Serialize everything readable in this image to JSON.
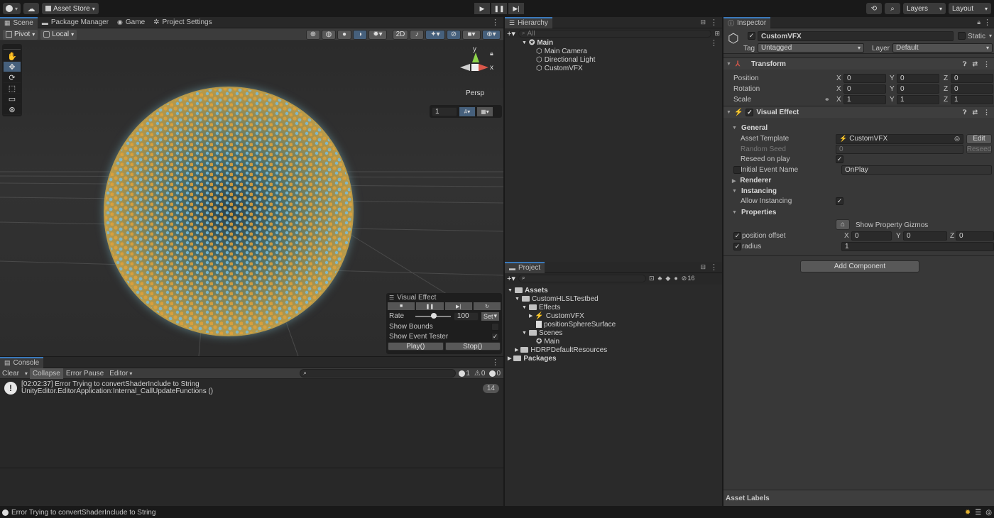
{
  "toolbar": {
    "account_icon": "account-icon",
    "asset_store": "Asset Store"
  },
  "scene_tabs": [
    {
      "label": "Scene",
      "icon": "scene-icon"
    },
    {
      "label": "Package Manager",
      "icon": "package-icon"
    },
    {
      "label": "Game",
      "icon": "game-icon"
    },
    {
      "label": "Project Settings",
      "icon": "gear-icon"
    }
  ],
  "scene_toolbar": {
    "pivot": "Pivot",
    "local": "Local",
    "mode_2d": "2D"
  },
  "gizmo": {
    "y": "y",
    "x": "x",
    "persp": "Persp",
    "grid_value": "1"
  },
  "vfx_overlay": {
    "title": "Visual Effect",
    "rate_label": "Rate",
    "rate_value": "100",
    "set_label": "Set",
    "show_bounds": "Show Bounds",
    "show_event_tester": "Show Event Tester",
    "play": "Play()",
    "stop": "Stop()"
  },
  "console": {
    "tab": "Console",
    "clear": "Clear",
    "collapse": "Collapse",
    "error_pause": "Error Pause",
    "editor": "Editor",
    "count_errors": "1",
    "count_warnings": "0",
    "count_logs": "0",
    "msg_line1": "[02:02:37] Error Trying to convertShaderInclude to String",
    "msg_line2": "UnityEditor.EditorApplication:Internal_CallUpdateFunctions ()",
    "msg_count": "14"
  },
  "status_bar": {
    "text": "Error Trying to convertShaderInclude to String"
  },
  "hierarchy": {
    "tab": "Hierarchy",
    "search_placeholder": "All",
    "scene": "Main",
    "items": [
      "Main Camera",
      "Directional Light",
      "CustomVFX"
    ]
  },
  "project": {
    "tab": "Project",
    "hidden_count": "16",
    "tree": [
      {
        "label": "Assets",
        "depth": 0,
        "type": "folder",
        "bold": true
      },
      {
        "label": "CustomHLSLTestbed",
        "depth": 1,
        "type": "folder"
      },
      {
        "label": "Effects",
        "depth": 2,
        "type": "folder"
      },
      {
        "label": "CustomVFX",
        "depth": 3,
        "type": "vfx"
      },
      {
        "label": "positionSphereSurface",
        "depth": 3,
        "type": "file"
      },
      {
        "label": "Scenes",
        "depth": 2,
        "type": "folder"
      },
      {
        "label": "Main",
        "depth": 3,
        "type": "scene"
      },
      {
        "label": "HDRPDefaultResources",
        "depth": 1,
        "type": "folder"
      },
      {
        "label": "Packages",
        "depth": 0,
        "type": "folder",
        "bold": true
      }
    ]
  },
  "top_right": {
    "layers": "Layers",
    "layout": "Layout"
  },
  "inspector": {
    "tab": "Inspector",
    "object_name": "CustomVFX",
    "static_label": "Static",
    "tag_label": "Tag",
    "tag_value": "Untagged",
    "layer_label": "Layer",
    "layer_value": "Default",
    "transform": {
      "title": "Transform",
      "position": {
        "label": "Position",
        "x": "0",
        "y": "0",
        "z": "0"
      },
      "rotation": {
        "label": "Rotation",
        "x": "0",
        "y": "0",
        "z": "0"
      },
      "scale": {
        "label": "Scale",
        "x": "1",
        "y": "1",
        "z": "1"
      }
    },
    "axis": {
      "x": "X",
      "y": "Y",
      "z": "Z"
    },
    "vfx": {
      "title": "Visual Effect",
      "general": "General",
      "asset_template_label": "Asset Template",
      "asset_template_value": "CustomVFX",
      "edit": "Edit",
      "random_seed_label": "Random Seed",
      "random_seed_value": "0",
      "reseed": "Reseed",
      "reseed_on_play": "Reseed on play",
      "initial_event_label": "Initial Event Name",
      "initial_event_value": "OnPlay",
      "renderer": "Renderer",
      "instancing": "Instancing",
      "allow_instancing": "Allow Instancing",
      "properties": "Properties",
      "show_gizmos": "Show Property Gizmos",
      "position_offset": {
        "label": "position offset",
        "x": "0",
        "y": "0",
        "z": "0"
      },
      "radius": {
        "label": "radius",
        "value": "1"
      }
    },
    "add_component": "Add Component",
    "asset_labels": "Asset Labels"
  },
  "colors": {
    "accent": "#3a79bb",
    "particle_orange": "#e0a23a",
    "particle_blue": "#7bbcd9"
  }
}
